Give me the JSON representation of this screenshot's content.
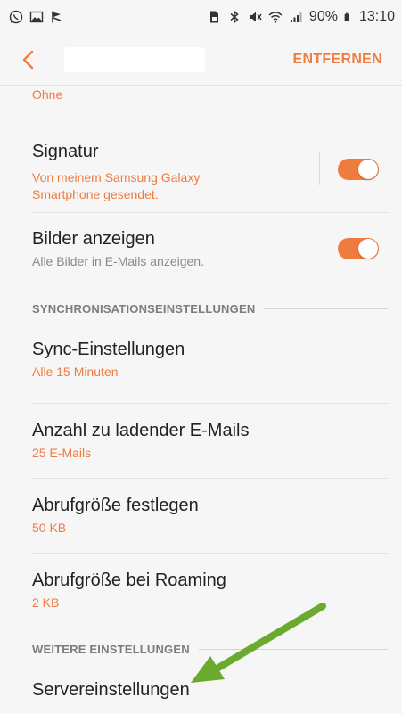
{
  "status_bar": {
    "battery": "90%",
    "time": "13:10",
    "left_icons": [
      "whatsapp-icon",
      "gallery-icon",
      "flag-icon"
    ],
    "right_icons": [
      "sim-icon",
      "bluetooth-icon",
      "mute-icon",
      "wifi-icon",
      "signal-icon",
      "battery-icon"
    ]
  },
  "toolbar": {
    "back_icon": "chevron-left-icon",
    "remove_label": "ENTFERNEN"
  },
  "list": {
    "partial_value": "Ohne",
    "signature": {
      "title": "Signatur",
      "subtitle": "Von meinem Samsung Galaxy Smartphone gesendet.",
      "toggle_on": true
    },
    "show_images": {
      "title": "Bilder anzeigen",
      "subtitle": "Alle Bilder in E-Mails anzeigen.",
      "toggle_on": true
    },
    "section_sync": "SYNCHRONISATIONSEINSTELLUNGEN",
    "sync_settings": {
      "title": "Sync-Einstellungen",
      "subtitle": "Alle 15 Minuten"
    },
    "email_count": {
      "title": "Anzahl zu ladender E-Mails",
      "subtitle": "25 E-Mails"
    },
    "fetch_size": {
      "title": "Abrufgröße festlegen",
      "subtitle": "50 KB"
    },
    "roaming_fetch_size": {
      "title": "Abrufgröße bei Roaming",
      "subtitle": "2 KB"
    },
    "section_more": "WEITERE EINSTELLUNGEN",
    "server_settings": {
      "title": "Servereinstellungen"
    }
  },
  "colors": {
    "accent": "#f07b3f",
    "arrow": "#6aaa2e",
    "background": "#f6f6f6"
  }
}
